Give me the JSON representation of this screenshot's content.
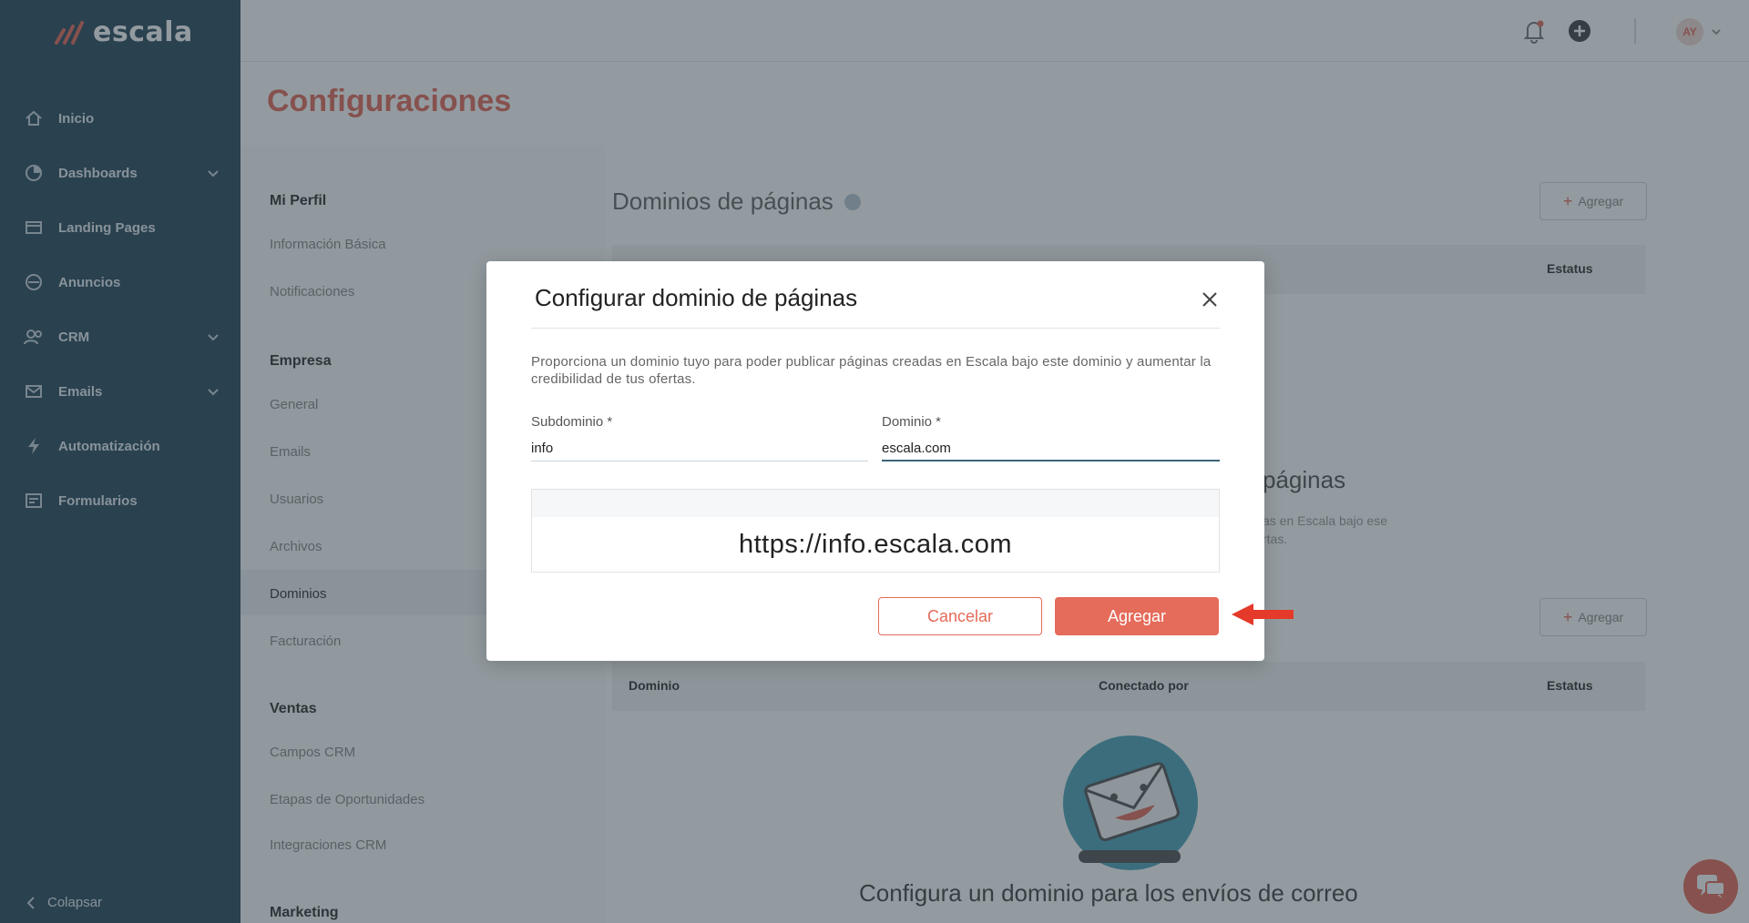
{
  "brand": {
    "name": "escala",
    "accent": "#e56b5a",
    "sidebar_bg": "#2d4a5c"
  },
  "sidebar": {
    "items": [
      {
        "label": "Inicio",
        "icon": "home-icon",
        "expandable": false
      },
      {
        "label": "Dashboards",
        "icon": "dashboard-icon",
        "expandable": true
      },
      {
        "label": "Landing Pages",
        "icon": "landing-pages-icon",
        "expandable": false
      },
      {
        "label": "Anuncios",
        "icon": "megaphone-icon",
        "expandable": false
      },
      {
        "label": "CRM",
        "icon": "users-icon",
        "expandable": true
      },
      {
        "label": "Emails",
        "icon": "mail-icon",
        "expandable": true
      },
      {
        "label": "Automatización",
        "icon": "lightning-icon",
        "expandable": false
      },
      {
        "label": "Formularios",
        "icon": "form-icon",
        "expandable": false
      }
    ],
    "collapse_label": "Colapsar"
  },
  "header": {
    "avatar_initials": "AY"
  },
  "page": {
    "title": "Configuraciones"
  },
  "settings_menu": {
    "sections": [
      {
        "title": "Mi Perfil",
        "items": [
          "Información Básica",
          "Notificaciones"
        ]
      },
      {
        "title": "Empresa",
        "items": [
          "General",
          "Emails",
          "Usuarios",
          "Archivos",
          "Dominios",
          "Facturación"
        ]
      },
      {
        "title": "Ventas",
        "items": [
          "Campos CRM",
          "Etapas de Oportunidades",
          "Integraciones CRM"
        ]
      },
      {
        "title": "Marketing",
        "items": []
      }
    ],
    "active_item": "Dominios"
  },
  "content": {
    "pages_title": "Dominios de páginas",
    "add_label": "Agregar",
    "status_col": "Estatus",
    "empty_title_fragment": "páginas",
    "empty_sub_line1": "as en Escala bajo ese",
    "empty_sub_line2": "rtas.",
    "email_table": {
      "col_domain": "Dominio",
      "col_connected": "Conectado por",
      "col_status": "Estatus"
    },
    "email_empty_title": "Configura un dominio para los envíos de correo"
  },
  "modal": {
    "title": "Configurar dominio de páginas",
    "description": "Proporciona un dominio tuyo para poder publicar páginas creadas en Escala bajo este dominio y aumentar la credibilidad de tus ofertas.",
    "subdomain_label": "Subdominio *",
    "subdomain_value": "info",
    "domain_label": "Dominio *",
    "domain_value": "escala.com",
    "preview_url": "https://info.escala.com",
    "cancel_label": "Cancelar",
    "add_label": "Agregar"
  }
}
